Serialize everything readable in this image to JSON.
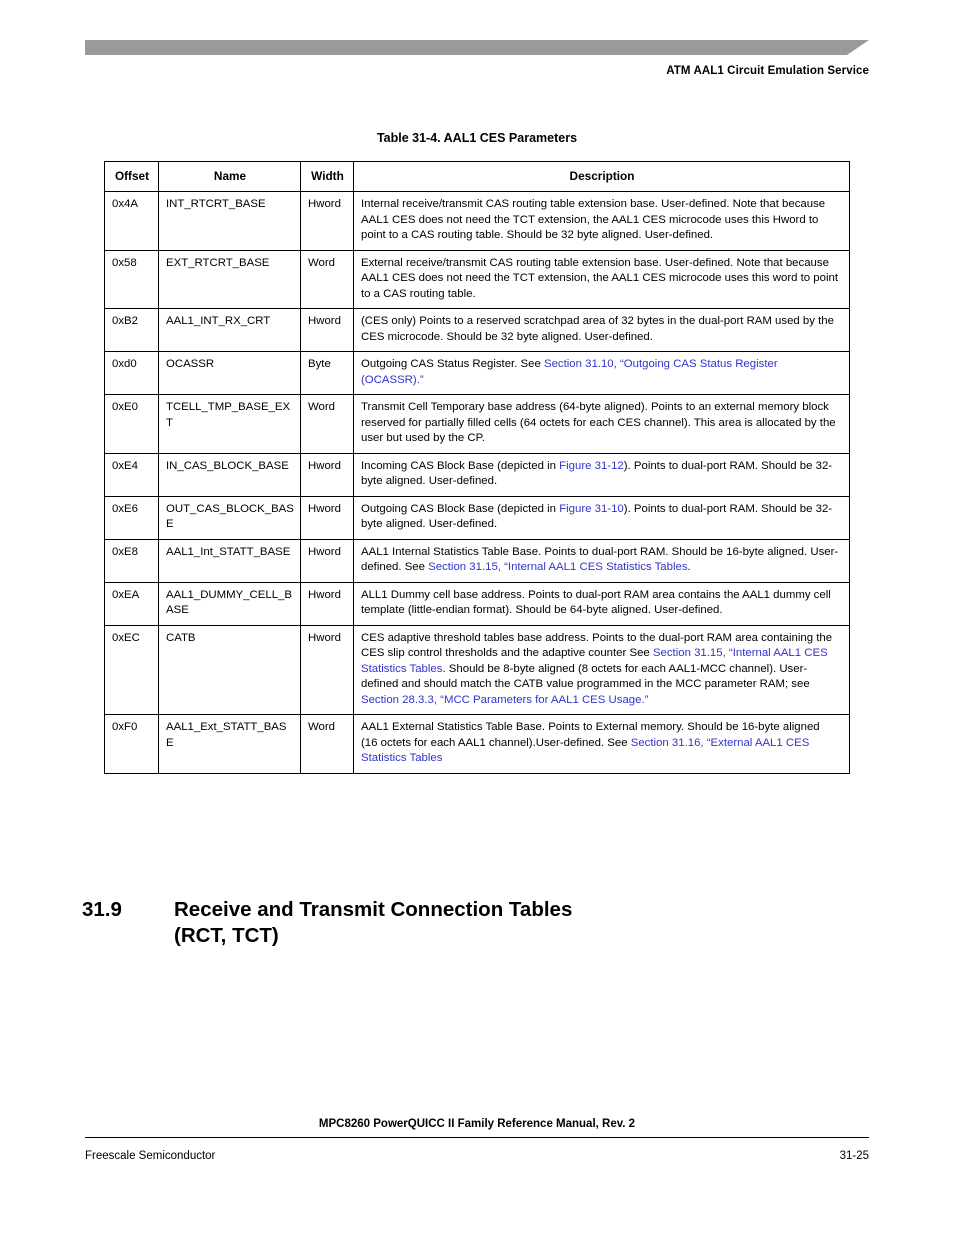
{
  "header": {
    "title": "ATM AAL1 Circuit Emulation Service",
    "bar_color": "#9a9a9a"
  },
  "table": {
    "caption": "Table 31-4. AAL1 CES Parameters",
    "link_color": "#3333cc",
    "columns": [
      "Offset",
      "Name",
      "Width",
      "Description"
    ],
    "rows": [
      {
        "offset": "0x4A",
        "name": "INT_RTCRT_BASE",
        "width": "Hword",
        "description": "Internal receive/transmit CAS routing table extension base. User-defined. Note that because AAL1 CES does not need the TCT extension, the AAL1 CES microcode uses this Hword to point to a CAS routing table. Should be 32 byte aligned. User-defined."
      },
      {
        "offset": "0x58",
        "name": "EXT_RTCRT_BASE",
        "width": "Word",
        "description": "External receive/transmit CAS routing table extension base. User-defined. Note that because AAL1 CES does not need the TCT extension, the AAL1 CES microcode uses this word to point to a CAS routing table."
      },
      {
        "offset": "0xB2",
        "name": "AAL1_INT_RX_CRT",
        "width": "Hword",
        "description": "(CES only) Points to a reserved scratchpad area of 32 bytes in the dual-port RAM used by the CES microcode. Should be 32 byte aligned. User-defined."
      },
      {
        "offset": "0xd0",
        "name": "OCASSR",
        "width": "Byte",
        "description_parts": [
          {
            "text": "Outgoing CAS Status Register. See ",
            "link": false
          },
          {
            "text": "Section 31.10, “Outgoing CAS Status Register (OCASSR).”",
            "link": true
          }
        ]
      },
      {
        "offset": "0xE0",
        "name": "TCELL_TMP_BASE_EXT",
        "width": "Word",
        "description": "Transmit Cell Temporary base address (64-byte aligned). Points to an external memory block reserved for partially filled cells (64 octets for each CES channel). This area is allocated by the user but used by the CP."
      },
      {
        "offset": "0xE4",
        "name": "IN_CAS_BLOCK_BASE",
        "width": "Hword",
        "description_parts": [
          {
            "text": "Incoming CAS Block Base (depicted in ",
            "link": false
          },
          {
            "text": "Figure 31-12",
            "link": true
          },
          {
            "text": "). Points to dual-port RAM. Should be 32-byte aligned. User-defined.",
            "link": false
          }
        ]
      },
      {
        "offset": "0xE6",
        "name": "OUT_CAS_BLOCK_BASE",
        "width": "Hword",
        "description_parts": [
          {
            "text": "Outgoing CAS Block Base (depicted in ",
            "link": false
          },
          {
            "text": "Figure 31-10",
            "link": true
          },
          {
            "text": "). Points to dual-port RAM. Should be 32-byte aligned. User-defined.",
            "link": false
          }
        ]
      },
      {
        "offset": "0xE8",
        "name": "AAL1_Int_STATT_BASE",
        "width": "Hword",
        "description_parts": [
          {
            "text": "AAL1 Internal Statistics Table Base. Points to dual-port RAM. Should be 16-byte aligned. User-defined. See ",
            "link": false
          },
          {
            "text": "Section 31.15, “Internal AAL1 CES Statistics Tables",
            "link": true
          },
          {
            "text": ".",
            "link": false
          }
        ]
      },
      {
        "offset": "0xEA",
        "name": "AAL1_DUMMY_CELL_BASE",
        "width": "Hword",
        "description": "ALL1 Dummy cell base address. Points to dual-port RAM area contains the AAL1 dummy cell template (little-endian format). Should be 64-byte aligned. User-defined."
      },
      {
        "offset": "0xEC",
        "name": "CATB",
        "width": "Hword",
        "description_parts": [
          {
            "text": "CES adaptive threshold tables base address. Points to the dual-port RAM area containing the CES slip control thresholds and the adaptive counter See ",
            "link": false
          },
          {
            "text": "Section 31.15, “Internal AAL1 CES Statistics Tables",
            "link": true
          },
          {
            "text": ".   Should be 8-byte aligned (8 octets for each AAL1-MCC channel). User-defined and should match the CATB value programmed in the MCC parameter RAM; see ",
            "link": false
          },
          {
            "text": "Section 28.3.3, “MCC Parameters for AAL1 CES Usage.”",
            "link": true
          }
        ]
      },
      {
        "offset": "0xF0",
        "name": "AAL1_Ext_STATT_BASE",
        "width": "Word",
        "description_parts": [
          {
            "text": "AAL1 External Statistics Table Base. Points to External memory. Should be 16-byte aligned (16 octets for each AAL1 channel).User-defined. See ",
            "link": false
          },
          {
            "text": "Section 31.16, “External AAL1 CES Statistics Tables",
            "link": true
          }
        ]
      }
    ]
  },
  "section": {
    "number": "31.9",
    "title": "Receive and Transmit Connection Tables (RCT, TCT)"
  },
  "footer": {
    "manual": "MPC8260 PowerQUICC II Family Reference Manual, Rev. 2",
    "company": "Freescale Semiconductor",
    "page": "31-25"
  }
}
